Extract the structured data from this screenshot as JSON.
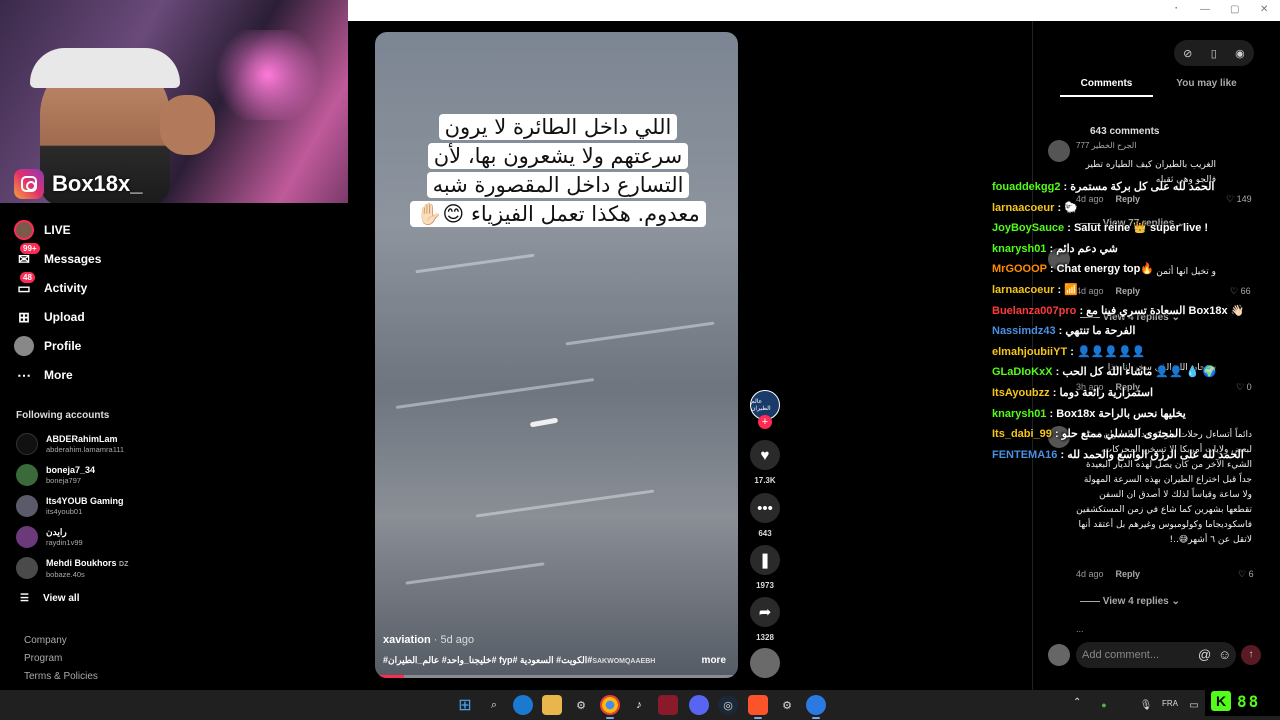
{
  "streamer": {
    "name": "Box18x_"
  },
  "sidebar": {
    "nav": [
      {
        "label": "LIVE"
      },
      {
        "label": "Messages",
        "badge": "99+"
      },
      {
        "label": "Activity",
        "badge": "48"
      },
      {
        "label": "Upload"
      },
      {
        "label": "Profile"
      },
      {
        "label": "More"
      }
    ],
    "following_title": "Following accounts",
    "accounts": [
      {
        "name": "ABDERahimLam",
        "handle": "abderahim.lamamra111"
      },
      {
        "name": "boneja7_34",
        "handle": "boneja797"
      },
      {
        "name": "Its4YOUB Gaming",
        "handle": "its4youb01"
      },
      {
        "name": "رايدن",
        "handle": "raydin1v99"
      },
      {
        "name": "Mehdi Boukhors",
        "name_suffix": "DZ",
        "handle": "bobaze.40s"
      }
    ],
    "view_all": "View all",
    "footer": [
      "Company",
      "Program",
      "Terms & Policies"
    ]
  },
  "video": {
    "caption": "اللي داخل الطائرة لا يرون سرعتهم ولا يشعرون بها، لأن التسارع داخل المقصورة شبه معدوم. هكذا تعمل الفيزياء 😊✋🏻",
    "author": "xaviation",
    "ago": "· 5d ago",
    "tags": "#خليجنا_واحد# عالم_الطيران# fyp# الكويت# السعودية#",
    "tags_suffix": "SAKWOMQAAEBH",
    "more": "more",
    "progress": 0.08,
    "channel_avatar_text": "عالم الطيران"
  },
  "actions": {
    "likes": "17.3K",
    "comments": "643",
    "saves": "1973",
    "shares": "1328"
  },
  "panel": {
    "tabs": [
      "Comments",
      "You may like"
    ],
    "comment_count": "643 comments",
    "comments": [
      {
        "user": "الجرح الخطير 777",
        "text": "الغريب بالطيران كيف الطياره تطير فالجو وهي ثقيله",
        "ago": "4d ago",
        "reply": "Reply",
        "likes": "149",
        "replies": "View 77 replies"
      },
      {
        "user": "",
        "text": "و تخيل انها أثمن",
        "ago": "4d ago",
        "reply": "Reply",
        "likes": "66",
        "replies": "View 4 replies"
      },
      {
        "user": "",
        "text": "سبحان الله الذي سخر لنا هذا",
        "ago": "3h ago",
        "reply": "Reply",
        "likes": "0",
        "replies": ""
      },
      {
        "user": "",
        "text": "دائماً أتساءل رحلات طويلة جداً بالطيران تحتاج لبعض ولايات أمريكا الا تسخن المحركات، الشيء الآخر من كان يصل لهذه الديار البعيدة جداً قبل اختراع الطيران بهذه السرعة المهولة ولا ساعة وقياساً لذلك لا أصدق ان السفن تقطعها بشهرين كما شاع في زمن المستكشفين فاسكوديجاما وكولومبوس وغيرهم بل أعتقد أنها لاتقل عن ٦ أشهر😅..!",
        "ago": "4d ago",
        "reply": "Reply",
        "likes": "6",
        "replies": "View 4 replies"
      }
    ],
    "ellipsis": "...",
    "input_placeholder": "Add comment..."
  },
  "chat": [
    {
      "user": "fouaddekgg2",
      "color": "#53fc18",
      "msg": ": الحمد لله على كل بركة مستمرة"
    },
    {
      "user": "larnaacoeur",
      "color": "#f5c518",
      "msg": ": 🐑"
    },
    {
      "user": "JoyBoySauce",
      "color": "#53fc18",
      "msg": ": Salut reine 👑 super live !"
    },
    {
      "user": "knarysh01",
      "color": "#53fc18",
      "msg": ": شي دعم دائم"
    },
    {
      "user": "MrGOOOP",
      "color": "#ff8c00",
      "msg": ": Chat energy top🔥"
    },
    {
      "user": "larnaacoeur",
      "color": "#f5c518",
      "msg": ": 📶"
    },
    {
      "user": "Buelanza007pro",
      "color": "#ff3b3b",
      "msg": ": السعادة تسري فينا مع Box18x 👋🏻"
    },
    {
      "user": "Nassimdz43",
      "color": "#4a90e2",
      "msg": ": الفرحة ما تنتهي"
    },
    {
      "user": "elmahjoubiiYT",
      "color": "#f5c518",
      "msg": ": 👤👤👤👤👤"
    },
    {
      "user": "GLaDIoKxX",
      "color": "#53fc18",
      "msg": ": ماشاء الله كل الحب 👤👤 💧 🌍"
    },
    {
      "user": "ItsAyoubzz",
      "color": "#f5c518",
      "msg": ": استمرارية رائعة دوما"
    },
    {
      "user": "knarysh01",
      "color": "#53fc18",
      "msg": ": Box18x يخليها نحس بالراحة"
    },
    {
      "user": "Its_dabi_99",
      "color": "#f5c518",
      "msg": ": المحتوى المسلي ممتع حلو"
    },
    {
      "user": "FENTEMA16",
      "color": "#4a90e2",
      "msg": ": الحمد لله على الرزق الواسع والحمد لله"
    }
  ],
  "taskbar": {
    "language": "FRA",
    "kick_viewers": "88"
  },
  "colors": {
    "accent": "#fe2c55",
    "kick": "#53fc18"
  }
}
